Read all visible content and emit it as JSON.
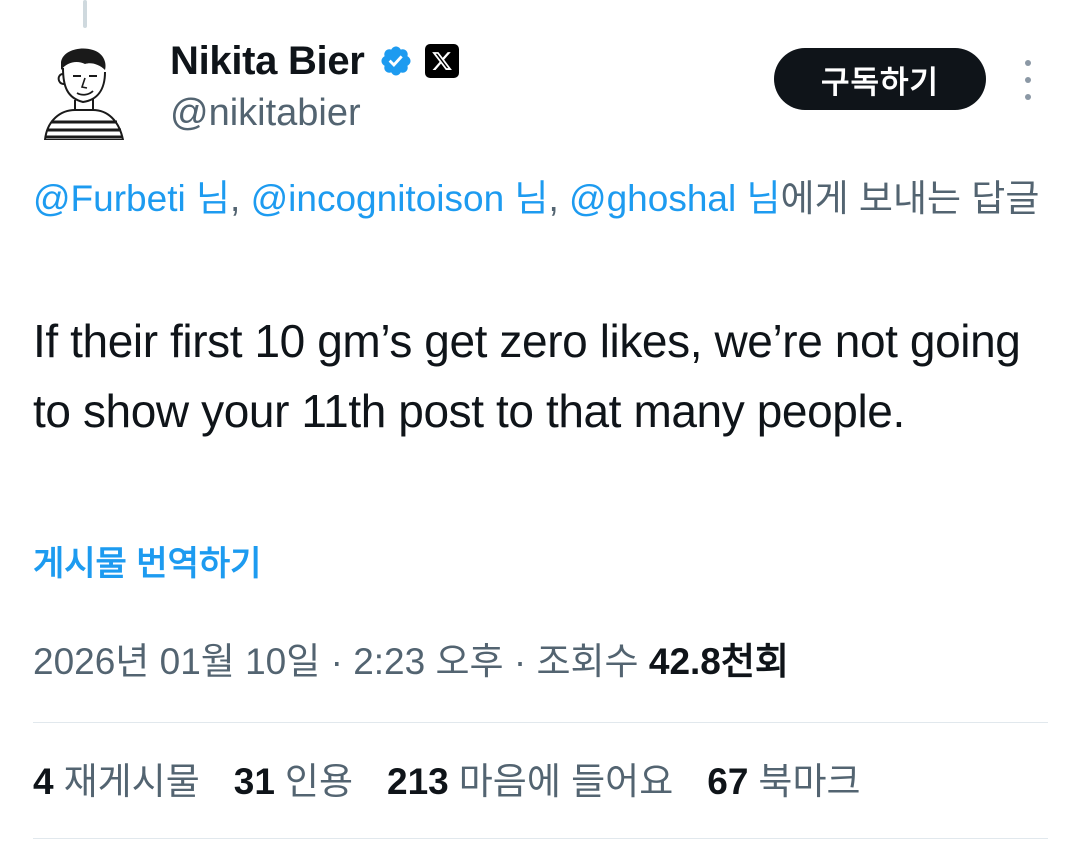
{
  "author": {
    "display_name": "Nikita Bier",
    "handle": "@nikitabier",
    "avatar_icon": "sketch-portrait-avatar",
    "verified_icon": "verified-badge-icon",
    "affiliate_icon": "x-logo-icon"
  },
  "actions": {
    "subscribe_label": "구독하기",
    "more_icon": "more-vertical-icon"
  },
  "reply_to": {
    "mentions": [
      "@Furbeti 님",
      "@incognitoison 님",
      "@ghoshal 님"
    ],
    "separator": ", ",
    "suffix": "에게 보내는 답글"
  },
  "tweet": {
    "text": "If their first 10 gm’s get zero likes, we’re not going to show your 11th post to that many people.",
    "translate_label": "게시물 번역하기"
  },
  "meta": {
    "date": "2026년 01월 10일",
    "dot": " · ",
    "time": "2:23 오후",
    "views_label": "조회수",
    "views_count": "42.8천회"
  },
  "stats": [
    {
      "count": "4",
      "label": "재게시물"
    },
    {
      "count": "31",
      "label": "인용"
    },
    {
      "count": "213",
      "label": "마음에 들어요"
    },
    {
      "count": "67",
      "label": "북마크"
    }
  ],
  "colors": {
    "accent": "#1d9bf0",
    "text": "#0f1419",
    "secondary": "#536471",
    "button_bg": "#0f1419"
  }
}
